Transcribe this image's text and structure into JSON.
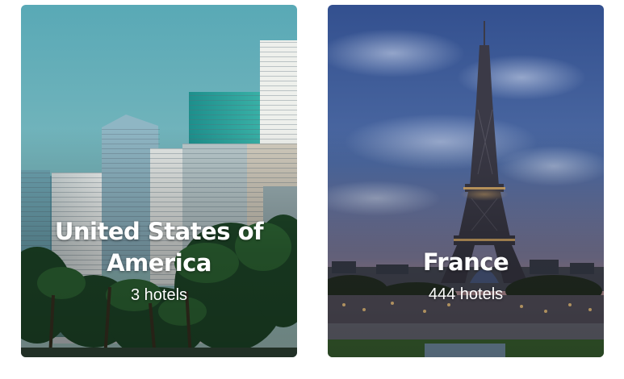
{
  "cards": [
    {
      "name": "United States of America",
      "hotels_label": "3 hotels"
    },
    {
      "name": "France",
      "hotels_label": "444 hotels"
    }
  ]
}
